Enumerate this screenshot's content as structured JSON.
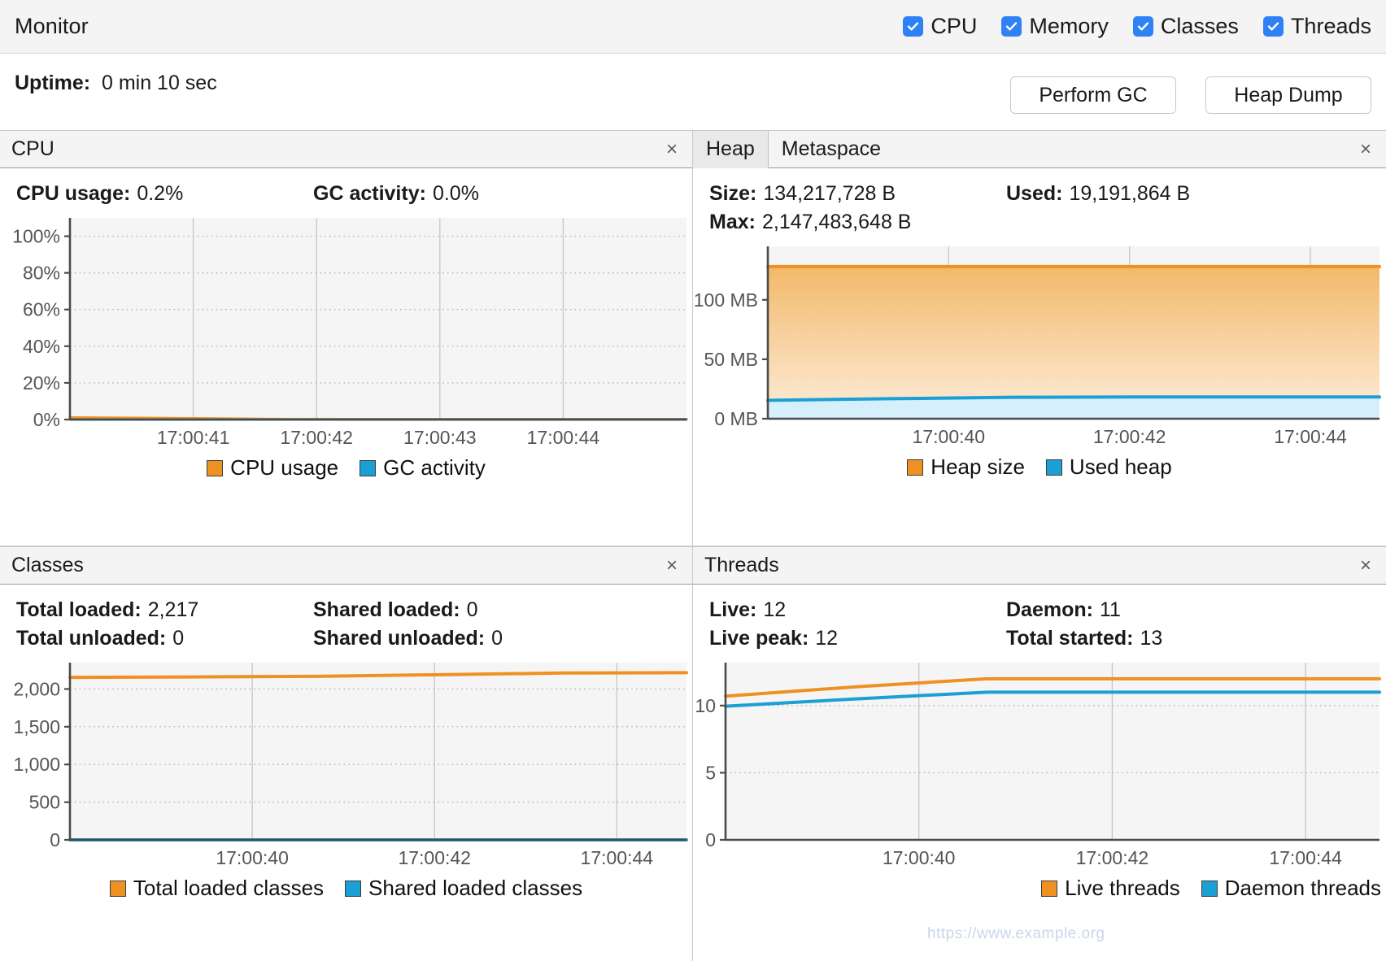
{
  "header": {
    "title": "Monitor",
    "checkboxes": [
      {
        "label": "CPU",
        "checked": true
      },
      {
        "label": "Memory",
        "checked": true
      },
      {
        "label": "Classes",
        "checked": true
      },
      {
        "label": "Threads",
        "checked": true
      }
    ],
    "uptime_label": "Uptime:",
    "uptime_value": "0 min 10 sec",
    "buttons": [
      {
        "label": "Perform GC"
      },
      {
        "label": "Heap Dump"
      }
    ]
  },
  "colors": {
    "orange": "#ef9122",
    "blue": "#1c9fd4",
    "orange_fill_top": "#f2b96a",
    "orange_fill_bottom": "#fdeddb",
    "blue_fill": "#d6f0fb",
    "checkbox": "#2f82f5",
    "plot_bg": "#f5f5f5",
    "grid": "#bcbcbc"
  },
  "panels": {
    "cpu": {
      "title": "CPU",
      "close": "×",
      "stats": [
        {
          "label": "CPU usage:",
          "value": "0.2%"
        },
        {
          "label": "GC activity:",
          "value": "0.0%"
        }
      ],
      "legend": [
        {
          "label": "CPU usage",
          "color": "#ef9122"
        },
        {
          "label": "GC activity",
          "color": "#1c9fd4"
        }
      ]
    },
    "heap": {
      "tabs": [
        {
          "label": "Heap",
          "active": true
        },
        {
          "label": "Metaspace",
          "active": false
        }
      ],
      "close": "×",
      "stats": [
        {
          "label": "Size:",
          "value": "134,217,728 B"
        },
        {
          "label": "Used:",
          "value": "19,191,864 B"
        },
        {
          "label": "Max:",
          "value": "2,147,483,648 B"
        }
      ],
      "legend": [
        {
          "label": "Heap size",
          "color": "#ef9122"
        },
        {
          "label": "Used heap",
          "color": "#1c9fd4"
        }
      ]
    },
    "classes": {
      "title": "Classes",
      "close": "×",
      "stats": [
        {
          "label": "Total loaded:",
          "value": "2,217"
        },
        {
          "label": "Shared loaded:",
          "value": "0"
        },
        {
          "label": "Total unloaded:",
          "value": "0"
        },
        {
          "label": "Shared unloaded:",
          "value": "0"
        }
      ],
      "legend": [
        {
          "label": "Total loaded classes",
          "color": "#ef9122"
        },
        {
          "label": "Shared loaded classes",
          "color": "#1c9fd4"
        }
      ]
    },
    "threads": {
      "title": "Threads",
      "close": "×",
      "stats": [
        {
          "label": "Live:",
          "value": "12"
        },
        {
          "label": "Daemon:",
          "value": "11"
        },
        {
          "label": "Live peak:",
          "value": "12"
        },
        {
          "label": "Total started:",
          "value": "13"
        }
      ],
      "legend": [
        {
          "label": "Live threads",
          "color": "#ef9122"
        },
        {
          "label": "Daemon threads",
          "color": "#1c9fd4"
        }
      ]
    }
  },
  "watermark": "https://www.example.org",
  "chart_data": [
    {
      "id": "cpu",
      "type": "line",
      "title": "CPU",
      "xlabel": "",
      "ylabel": "",
      "ylim": [
        0,
        110
      ],
      "yticks": [
        0,
        20,
        40,
        60,
        80,
        100
      ],
      "yticklabels": [
        "0%",
        "20%",
        "40%",
        "60%",
        "80%",
        "100%"
      ],
      "xticklabels": [
        "17:00:41",
        "17:00:42",
        "17:00:43",
        "17:00:44"
      ],
      "grid": true,
      "legend_position": "bottom",
      "x": [
        0,
        0.5,
        1,
        1.5,
        2,
        2.5,
        3,
        3.5,
        4,
        4.5
      ],
      "series": [
        {
          "name": "CPU usage",
          "color": "#ef9122",
          "values": [
            1.1,
            0.9,
            0.6,
            0.3,
            0.2,
            0.2,
            0.2,
            0.2,
            0.2,
            0.2
          ]
        },
        {
          "name": "GC activity",
          "color": "#1c9fd4",
          "values": [
            0.0,
            0.0,
            0.0,
            0.0,
            0.0,
            0.0,
            0.0,
            0.0,
            0.0,
            0.0
          ]
        }
      ]
    },
    {
      "id": "heap",
      "type": "area",
      "title": "Heap",
      "xlabel": "",
      "ylabel": "",
      "ylim": [
        0,
        145
      ],
      "yticks": [
        0,
        50,
        100
      ],
      "yticklabels": [
        "0 MB",
        "50 MB",
        "100 MB"
      ],
      "xticklabels": [
        "17:00:40",
        "17:00:42",
        "17:00:44"
      ],
      "grid": true,
      "legend_position": "bottom",
      "x": [
        0,
        1,
        2,
        3,
        4,
        5
      ],
      "series": [
        {
          "name": "Heap size",
          "color": "#ef9122",
          "values": [
            128,
            128,
            128,
            128,
            128,
            128
          ],
          "unit": "MB"
        },
        {
          "name": "Used heap",
          "color": "#1c9fd4",
          "values": [
            15.5,
            16.8,
            18.0,
            18.3,
            18.3,
            18.3
          ],
          "unit": "MB"
        }
      ]
    },
    {
      "id": "classes",
      "type": "line",
      "title": "Classes",
      "xlabel": "",
      "ylabel": "",
      "ylim": [
        0,
        2350
      ],
      "yticks": [
        0,
        500,
        1000,
        1500,
        2000
      ],
      "yticklabels": [
        "0",
        "500",
        "1,000",
        "1,500",
        "2,000"
      ],
      "xticklabels": [
        "17:00:40",
        "17:00:42",
        "17:00:44"
      ],
      "grid": true,
      "legend_position": "bottom",
      "x": [
        0,
        1,
        2,
        3,
        4,
        5
      ],
      "series": [
        {
          "name": "Total loaded classes",
          "color": "#ef9122",
          "values": [
            2155,
            2160,
            2168,
            2190,
            2212,
            2217
          ]
        },
        {
          "name": "Shared loaded classes",
          "color": "#1c9fd4",
          "values": [
            0,
            0,
            0,
            0,
            0,
            0
          ]
        }
      ]
    },
    {
      "id": "threads",
      "type": "line",
      "title": "Threads",
      "xlabel": "",
      "ylabel": "",
      "ylim": [
        0,
        13.2
      ],
      "yticks": [
        0,
        5,
        10
      ],
      "yticklabels": [
        "0",
        "5",
        "10"
      ],
      "xticklabels": [
        "17:00:40",
        "17:00:42",
        "17:00:44"
      ],
      "grid": true,
      "legend_position": "bottom",
      "x": [
        0,
        1,
        2,
        3,
        4,
        5
      ],
      "series": [
        {
          "name": "Live threads",
          "color": "#ef9122",
          "values": [
            10.7,
            11.4,
            12,
            12,
            12,
            12
          ]
        },
        {
          "name": "Daemon threads",
          "color": "#1c9fd4",
          "values": [
            9.95,
            10.5,
            11,
            11,
            11,
            11
          ]
        }
      ]
    }
  ]
}
